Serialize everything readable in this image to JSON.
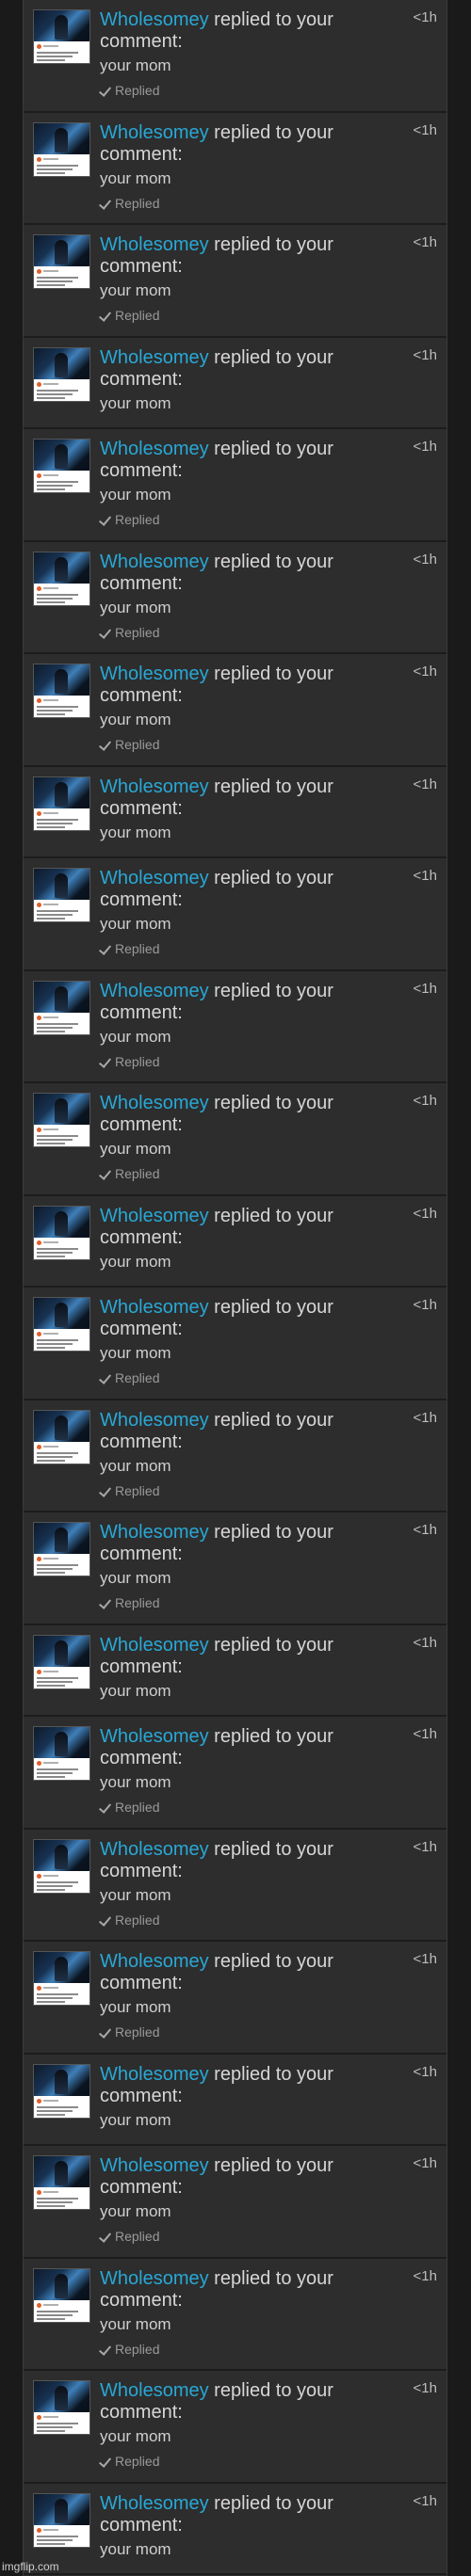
{
  "notifications": [
    {
      "user": "Wholesomey",
      "action": "replied to your comment:",
      "message": "your mom",
      "time": "<1h",
      "status": "Replied"
    },
    {
      "user": "Wholesomey",
      "action": "replied to your comment:",
      "message": "your mom",
      "time": "<1h",
      "status": "Replied"
    },
    {
      "user": "Wholesomey",
      "action": "replied to your comment:",
      "message": "your mom",
      "time": "<1h",
      "status": "Replied"
    },
    {
      "user": "Wholesomey",
      "action": "replied to your comment:",
      "message": "your mom",
      "time": "<1h",
      "status": ""
    },
    {
      "user": "Wholesomey",
      "action": "replied to your comment:",
      "message": "your mom",
      "time": "<1h",
      "status": "Replied"
    },
    {
      "user": "Wholesomey",
      "action": "replied to your comment:",
      "message": "your mom",
      "time": "<1h",
      "status": "Replied"
    },
    {
      "user": "Wholesomey",
      "action": "replied to your comment:",
      "message": "your mom",
      "time": "<1h",
      "status": "Replied"
    },
    {
      "user": "Wholesomey",
      "action": "replied to your comment:",
      "message": "your mom",
      "time": "<1h",
      "status": ""
    },
    {
      "user": "Wholesomey",
      "action": "replied to your comment:",
      "message": "your mom",
      "time": "<1h",
      "status": "Replied"
    },
    {
      "user": "Wholesomey",
      "action": "replied to your comment:",
      "message": "your mom",
      "time": "<1h",
      "status": "Replied"
    },
    {
      "user": "Wholesomey",
      "action": "replied to your comment:",
      "message": "your mom",
      "time": "<1h",
      "status": "Replied"
    },
    {
      "user": "Wholesomey",
      "action": "replied to your comment:",
      "message": "your mom",
      "time": "<1h",
      "status": ""
    },
    {
      "user": "Wholesomey",
      "action": "replied to your comment:",
      "message": "your mom",
      "time": "<1h",
      "status": "Replied"
    },
    {
      "user": "Wholesomey",
      "action": "replied to your comment:",
      "message": "your mom",
      "time": "<1h",
      "status": "Replied"
    },
    {
      "user": "Wholesomey",
      "action": "replied to your comment:",
      "message": "your mom",
      "time": "<1h",
      "status": "Replied"
    },
    {
      "user": "Wholesomey",
      "action": "replied to your comment:",
      "message": "your mom",
      "time": "<1h",
      "status": ""
    },
    {
      "user": "Wholesomey",
      "action": "replied to your comment:",
      "message": "your mom",
      "time": "<1h",
      "status": "Replied"
    },
    {
      "user": "Wholesomey",
      "action": "replied to your comment:",
      "message": "your mom",
      "time": "<1h",
      "status": "Replied"
    },
    {
      "user": "Wholesomey",
      "action": "replied to your comment:",
      "message": "your mom",
      "time": "<1h",
      "status": "Replied"
    },
    {
      "user": "Wholesomey",
      "action": "replied to your comment:",
      "message": "your mom",
      "time": "<1h",
      "status": ""
    },
    {
      "user": "Wholesomey",
      "action": "replied to your comment:",
      "message": "your mom",
      "time": "<1h",
      "status": "Replied"
    },
    {
      "user": "Wholesomey",
      "action": "replied to your comment:",
      "message": "your mom",
      "time": "<1h",
      "status": "Replied"
    },
    {
      "user": "Wholesomey",
      "action": "replied to your comment:",
      "message": "your mom",
      "time": "<1h",
      "status": "Replied"
    },
    {
      "user": "Wholesomey",
      "action": "replied to your comment:",
      "message": "your mom",
      "time": "<1h",
      "status": ""
    }
  ],
  "watermark": "imgflip.com",
  "colors": {
    "username": "#28a8d6",
    "background": "#2d2d2d"
  }
}
